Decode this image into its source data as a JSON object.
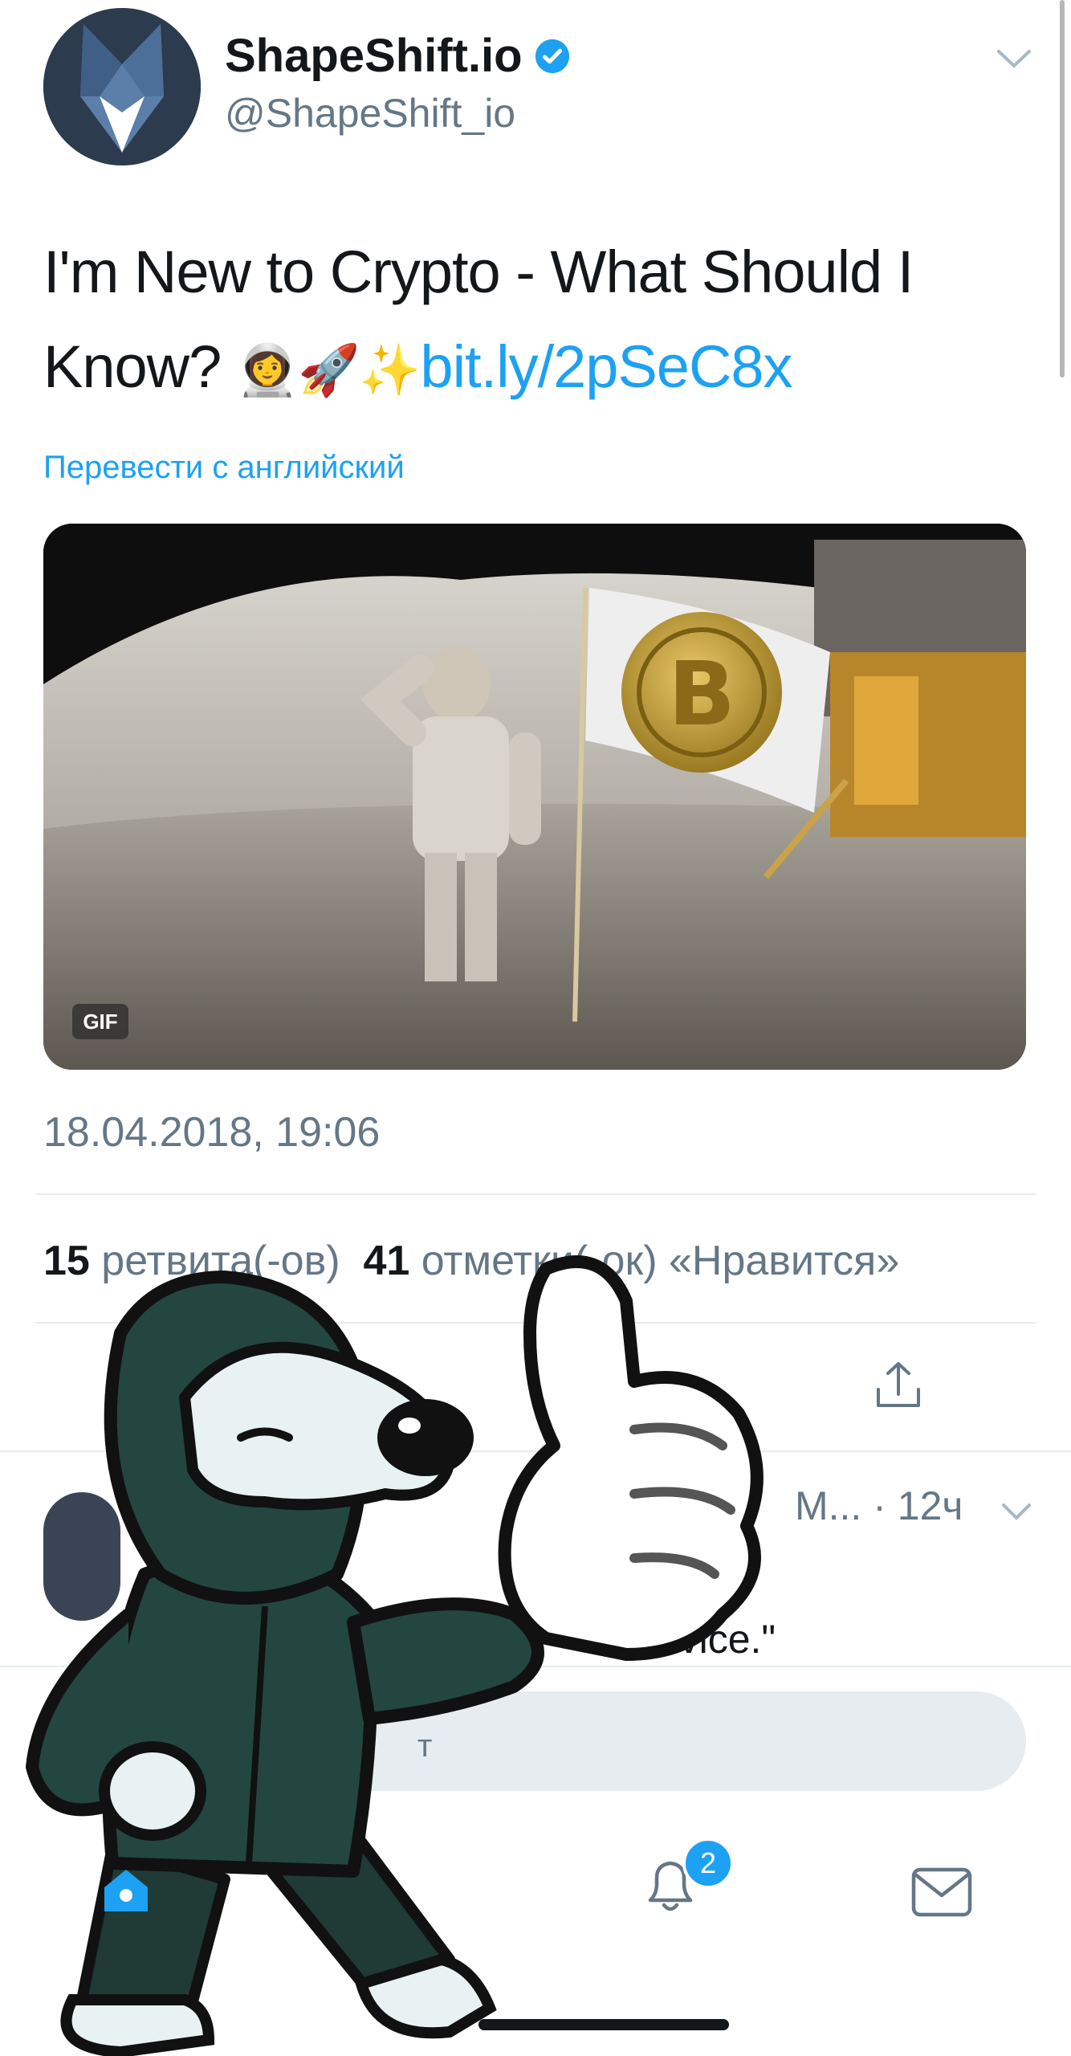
{
  "tweet": {
    "author_name": "ShapeShift.io",
    "author_handle": "@ShapeShift_io",
    "verified_icon": "verified-badge-icon",
    "text_part1": "I'm New to Crypto - What Should I Know?",
    "emojis": "👩‍🚀🚀✨",
    "link": "bit.ly/2pSeC8x",
    "translate_label": "Перевести с английский",
    "media_badge": "GIF",
    "timestamp": "18.04.2018, 19:06",
    "retweets_count": "15",
    "retweets_label": "ретвита(-ов)",
    "likes_count": "41",
    "likes_label": "отметки(-ок) «Нравится»"
  },
  "reply": {
    "name_truncated": "М...",
    "time": "· 12ч",
    "text_fragment": "advice.\""
  },
  "compose": {
    "placeholder_fragment": "т"
  },
  "tabbar": {
    "notifications_badge": "2"
  },
  "colors": {
    "accent": "#1da1f2",
    "text_primary": "#14171a",
    "text_secondary": "#657786",
    "divider": "#e6ecf0"
  }
}
